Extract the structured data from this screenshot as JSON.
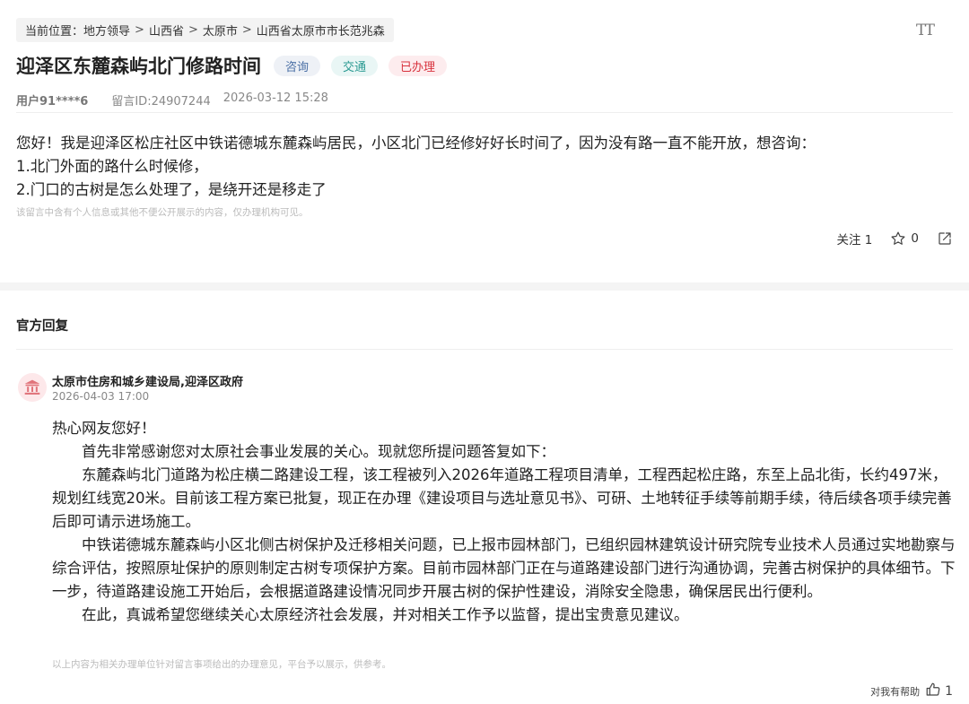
{
  "breadcrumb": {
    "prefix": "当前位置：",
    "items": [
      "地方领导",
      "山西省",
      "太原市",
      "山西省太原市市长范兆森"
    ],
    "separator": ">"
  },
  "font_size_button": "TT",
  "post": {
    "title": "迎泽区东麓森屿北门修路时间",
    "tags": [
      "咨询",
      "交通",
      "已办理"
    ],
    "user": "用户91****6",
    "message_id": "留言ID:24907244",
    "datetime": "2026-03-12 15:28",
    "body": [
      "您好！我是迎泽区松庄社区中铁诺德城东麓森屿居民，小区北门已经修好好长时间了，因为没有路一直不能开放，想咨询：",
      "1.北门外面的路什么时候修，",
      "2.门口的古树是怎么处理了，是绕开还是移走了"
    ],
    "privacy_note": "该留言中含有个人信息或其他不便公开展示的内容，仅办理机构可见。",
    "follow_label": "关注 1",
    "favorite_count": "0"
  },
  "official": {
    "header": "官方回复",
    "department": "太原市住房和城乡建设局,迎泽区政府",
    "datetime": "2026-04-03 17:00",
    "greeting": "热心网友您好！",
    "paragraphs": [
      "首先非常感谢您对太原社会事业发展的关心。现就您所提问题答复如下：",
      "东麓森屿北门道路为松庄横二路建设工程，该工程被列入2026年道路工程项目清单，工程西起松庄路，东至上品北街，长约497米，规划红线宽20米。目前该工程方案已批复，现正在办理《建设项目与选址意见书》、可研、土地转征手续等前期手续，待后续各项手续完善后即可请示进场施工。",
      "中铁诺德城东麓森屿小区北侧古树保护及迁移相关问题，已上报市园林部门，已组织园林建筑设计研究院专业技术人员通过实地勘察与综合评估，按照原址保护的原则制定古树专项保护方案。目前市园林部门正在与道路建设部门进行沟通协调，完善古树保护的具体细节。下一步，待道路建设施工开始后，会根据道路建设情况同步开展古树的保护性建设，消除安全隐患，确保居民出行便利。",
      "在此，真诚希望您继续关心太原经济社会发展，并对相关工作予以监督，提出宝贵意见建议。"
    ],
    "disclaimer": "以上内容为相关办理单位针对留言事项给出的办理意见，平台予以展示，供参考。",
    "helpful_label": "对我有帮助",
    "helpful_count": "1"
  },
  "colors": {
    "tag_consult": "#4a6fa5",
    "tag_traffic": "#2a9a92",
    "tag_done": "#d8323d"
  }
}
